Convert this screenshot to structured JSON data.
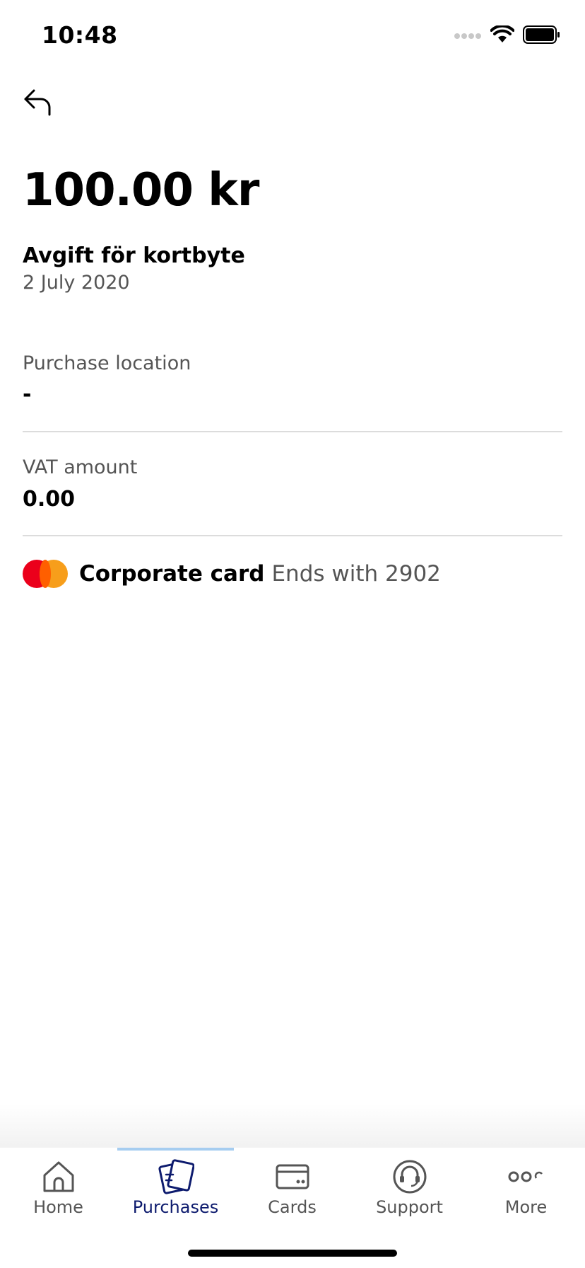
{
  "status_bar": {
    "time": "10:48",
    "icons": [
      "signal-icon",
      "wifi-icon",
      "battery-icon"
    ]
  },
  "navigation": {
    "back_icon": "back-arrow-icon"
  },
  "transaction": {
    "amount": "100.00 kr",
    "merchant": "Avgift för kortbyte",
    "date": "2 July 2020"
  },
  "details": [
    {
      "label": "Purchase location",
      "value": "-"
    },
    {
      "label": "VAT amount",
      "value": "0.00"
    }
  ],
  "card": {
    "brand_icon": "mastercard-logo-icon",
    "name": "Corporate card",
    "ends_with": "Ends with 2902"
  },
  "tab_bar": {
    "active_tab": "Purchases",
    "accent_color": "#0d1b6e",
    "indicator_color": "#a6cdf0",
    "tabs": [
      {
        "label": "Home",
        "icon": "home-icon"
      },
      {
        "label": "Purchases",
        "icon": "receipts-icon"
      },
      {
        "label": "Cards",
        "icon": "card-icon"
      },
      {
        "label": "Support",
        "icon": "headset-icon"
      },
      {
        "label": "More",
        "icon": "more-dots-icon"
      }
    ]
  }
}
